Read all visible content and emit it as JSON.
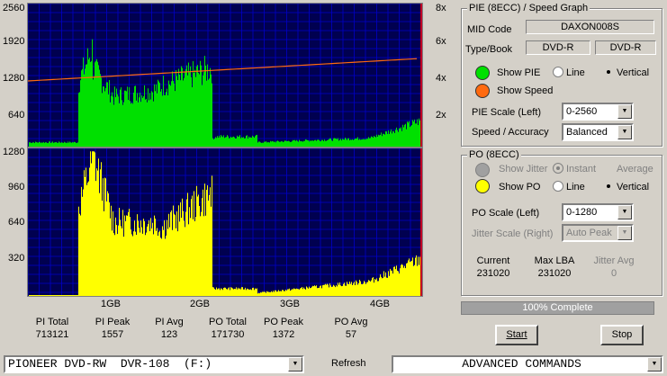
{
  "graph_top": {
    "left_axis": [
      "2560",
      "1920",
      "1280",
      "640"
    ],
    "right_axis": [
      "8x",
      "6x",
      "4x",
      "2x"
    ]
  },
  "graph_bottom": {
    "left_axis": [
      "1280",
      "960",
      "640",
      "320"
    ],
    "x_axis": [
      "1GB",
      "2GB",
      "3GB",
      "4GB"
    ]
  },
  "stats": {
    "labels": [
      "PI Total",
      "PI Peak",
      "PI Avg",
      "PO Total",
      "PO Peak",
      "PO Avg"
    ],
    "values": [
      "713121",
      "1557",
      "123",
      "171730",
      "1372",
      "57"
    ]
  },
  "pie_panel": {
    "title": "PIE (8ECC) / Speed Graph",
    "mid_label": "MID Code",
    "mid_value": "DAXON008S",
    "type_label": "Type/Book",
    "type_value": "DVD-R",
    "book_value": "DVD-R",
    "show_pie": "Show PIE",
    "show_speed": "Show Speed",
    "line": "Line",
    "vertical": "Vertical",
    "pie_scale_label": "PIE Scale (Left)",
    "pie_scale_value": "0-2560",
    "speed_label": "Speed / Accuracy",
    "speed_value": "Balanced",
    "pie_color": "#00e000",
    "speed_color": "#ff6a10"
  },
  "po_panel": {
    "title": "PO (8ECC)",
    "show_jitter": "Show Jitter",
    "instant": "Instant",
    "average": "Average",
    "show_po": "Show PO",
    "line": "Line",
    "vertical": "Vertical",
    "po_scale_label": "PO Scale (Left)",
    "po_scale_value": "0-1280",
    "jitter_scale_label": "Jitter Scale (Right)",
    "jitter_scale_value": "Auto Peak",
    "current_label": "Current",
    "current_value": "231020",
    "maxlba_label": "Max LBA",
    "maxlba_value": "231020",
    "jitter_avg_label": "Jitter Avg",
    "jitter_avg_value": "0",
    "po_color": "#ffff00"
  },
  "progress": {
    "label": "100% Complete",
    "percent": 100
  },
  "buttons": {
    "start": "Start",
    "stop": "Stop",
    "refresh": "Refresh"
  },
  "bottom": {
    "drive": "PIONEER DVD-RW  DVR-108  (F:)",
    "commands": "ADVANCED COMMANDS"
  },
  "colors": {
    "graph_bg": "#000050",
    "grid": "#0000c8",
    "end_marker": "#ff0000"
  }
}
